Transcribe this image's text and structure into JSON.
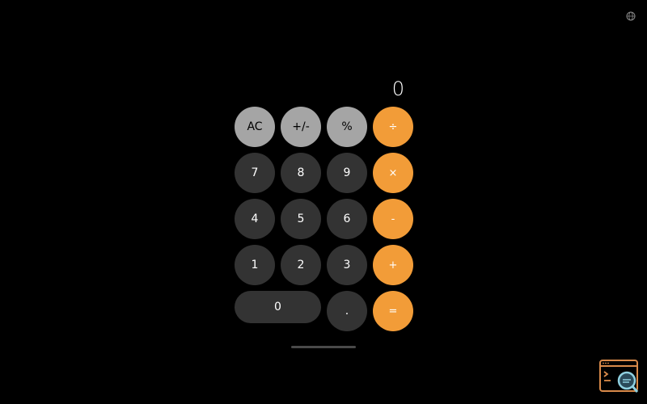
{
  "display": {
    "value": "0"
  },
  "keys": {
    "ac": "AC",
    "sign": "+/-",
    "percent": "%",
    "divide": "÷",
    "seven": "7",
    "eight": "8",
    "nine": "9",
    "multiply": "×",
    "four": "4",
    "five": "5",
    "six": "6",
    "minus": "-",
    "one": "1",
    "two": "2",
    "three": "3",
    "plus": "+",
    "zero": "0",
    "decimal": ".",
    "equals": "="
  },
  "colors": {
    "background": "#000000",
    "function_key": "#a5a5a5",
    "number_key": "#333333",
    "operator_key": "#f29c38"
  },
  "icons": {
    "top_right": "globe-icon",
    "bottom_right": "terminal-search-icon"
  }
}
